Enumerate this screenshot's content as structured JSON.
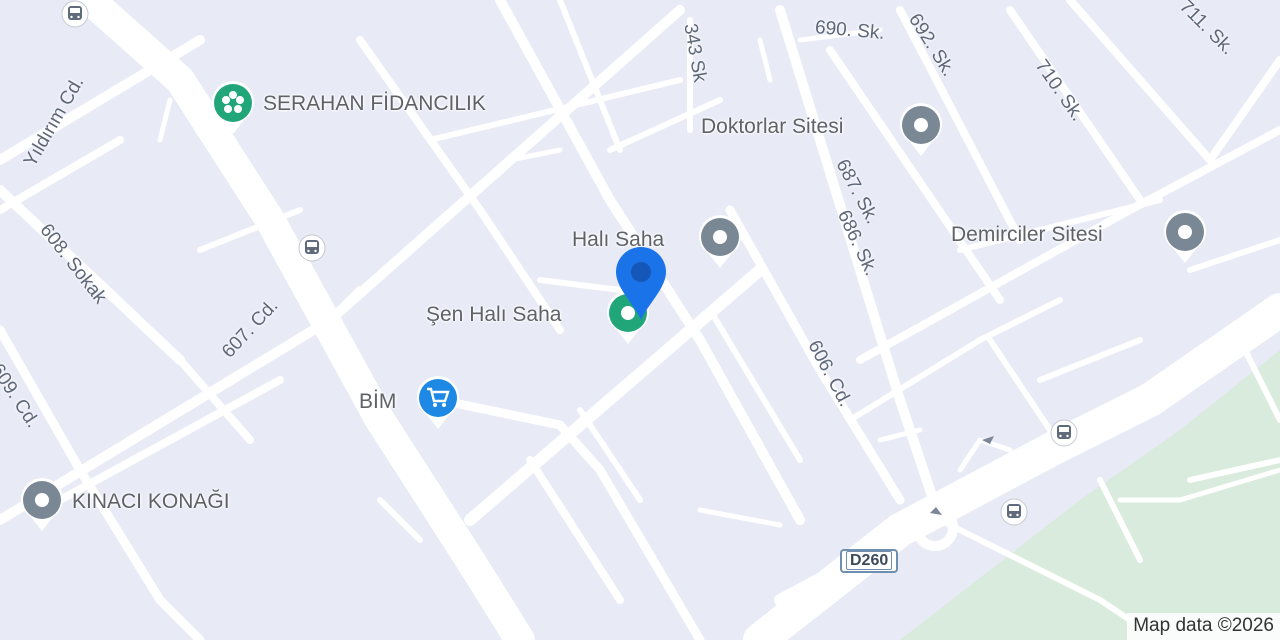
{
  "map": {
    "colors": {
      "land": "#e8eaf6",
      "road": "#ffffff",
      "park": "#d8ebdc",
      "accent_pin": "#1a73e8",
      "poi_green": "#21a67a",
      "poi_gray": "#7a8794",
      "poi_blue": "#1e88e5"
    },
    "pois": [
      {
        "name": "SERAHAN FİDANCILIK",
        "icon": "flower-icon"
      },
      {
        "name": "Doktorlar Sitesi",
        "icon": "location-icon"
      },
      {
        "name": "Halı Saha",
        "icon": "location-icon"
      },
      {
        "name": "Demirciler Sitesi",
        "icon": "location-icon"
      },
      {
        "name": "Şen Halı Saha",
        "icon": "sports-field-icon"
      },
      {
        "name": "BİM",
        "icon": "shopping-cart-icon"
      },
      {
        "name": "KINACI KONAĞI",
        "icon": "location-icon"
      }
    ],
    "streets": [
      "Yıldırım Cd.",
      "608. Sokak",
      "607. Cd.",
      "609. Cd.",
      "343 Sk",
      "690. Sk.",
      "692. Sk.",
      "711. Sk.",
      "710. Sk.",
      "687. Sk.",
      "686. Sk.",
      "606. Cd."
    ],
    "road_shield": "D260",
    "selected_marker": "location-pin-icon",
    "bus_stop_icon": "bus-stop-icon",
    "attribution": "Map data ©2026"
  }
}
